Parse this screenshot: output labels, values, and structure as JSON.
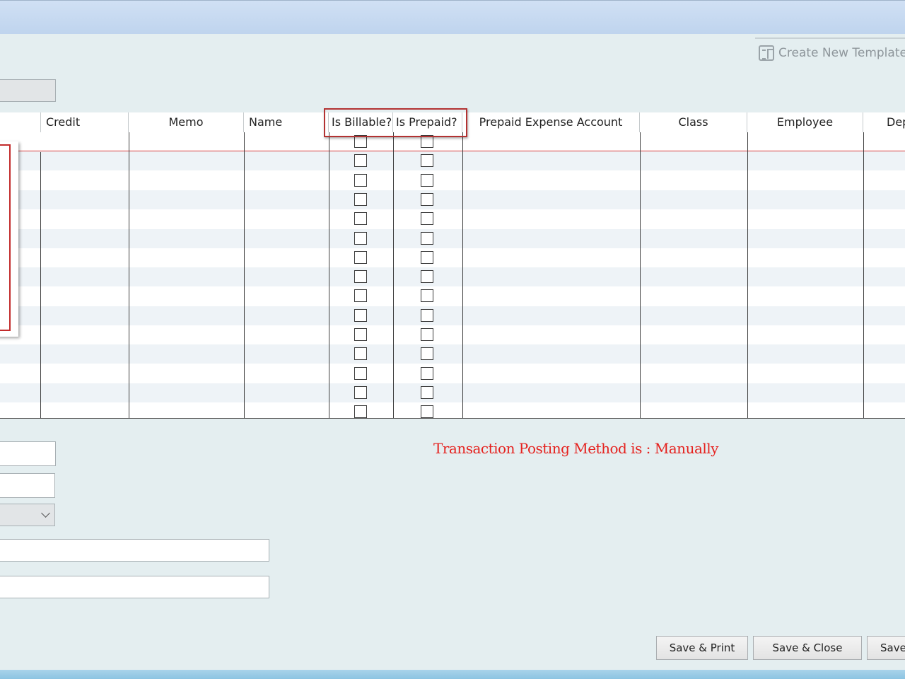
{
  "toolbar": {
    "create_template_label": "Create New Template",
    "create_template_icon": "template-icon"
  },
  "grid": {
    "columns": {
      "credit": "Credit",
      "memo": "Memo",
      "name": "Name",
      "is_billable": "Is Billable?",
      "is_prepaid": "Is Prepaid?",
      "prepaid_expense_account": "Prepaid Expense Account",
      "class": "Class",
      "employee": "Employee",
      "department": "Dep"
    },
    "row_count": 15
  },
  "status": {
    "posting_method": "Transaction Posting Method is : Manually",
    "posting_color": "#e5211e"
  },
  "buttons": {
    "save_print": "Save & Print",
    "save_close": "Save & Close",
    "save": "Save"
  },
  "colors": {
    "background": "#e4eef0",
    "highlight": "#b33232",
    "row_alt": "#eef3f7"
  }
}
